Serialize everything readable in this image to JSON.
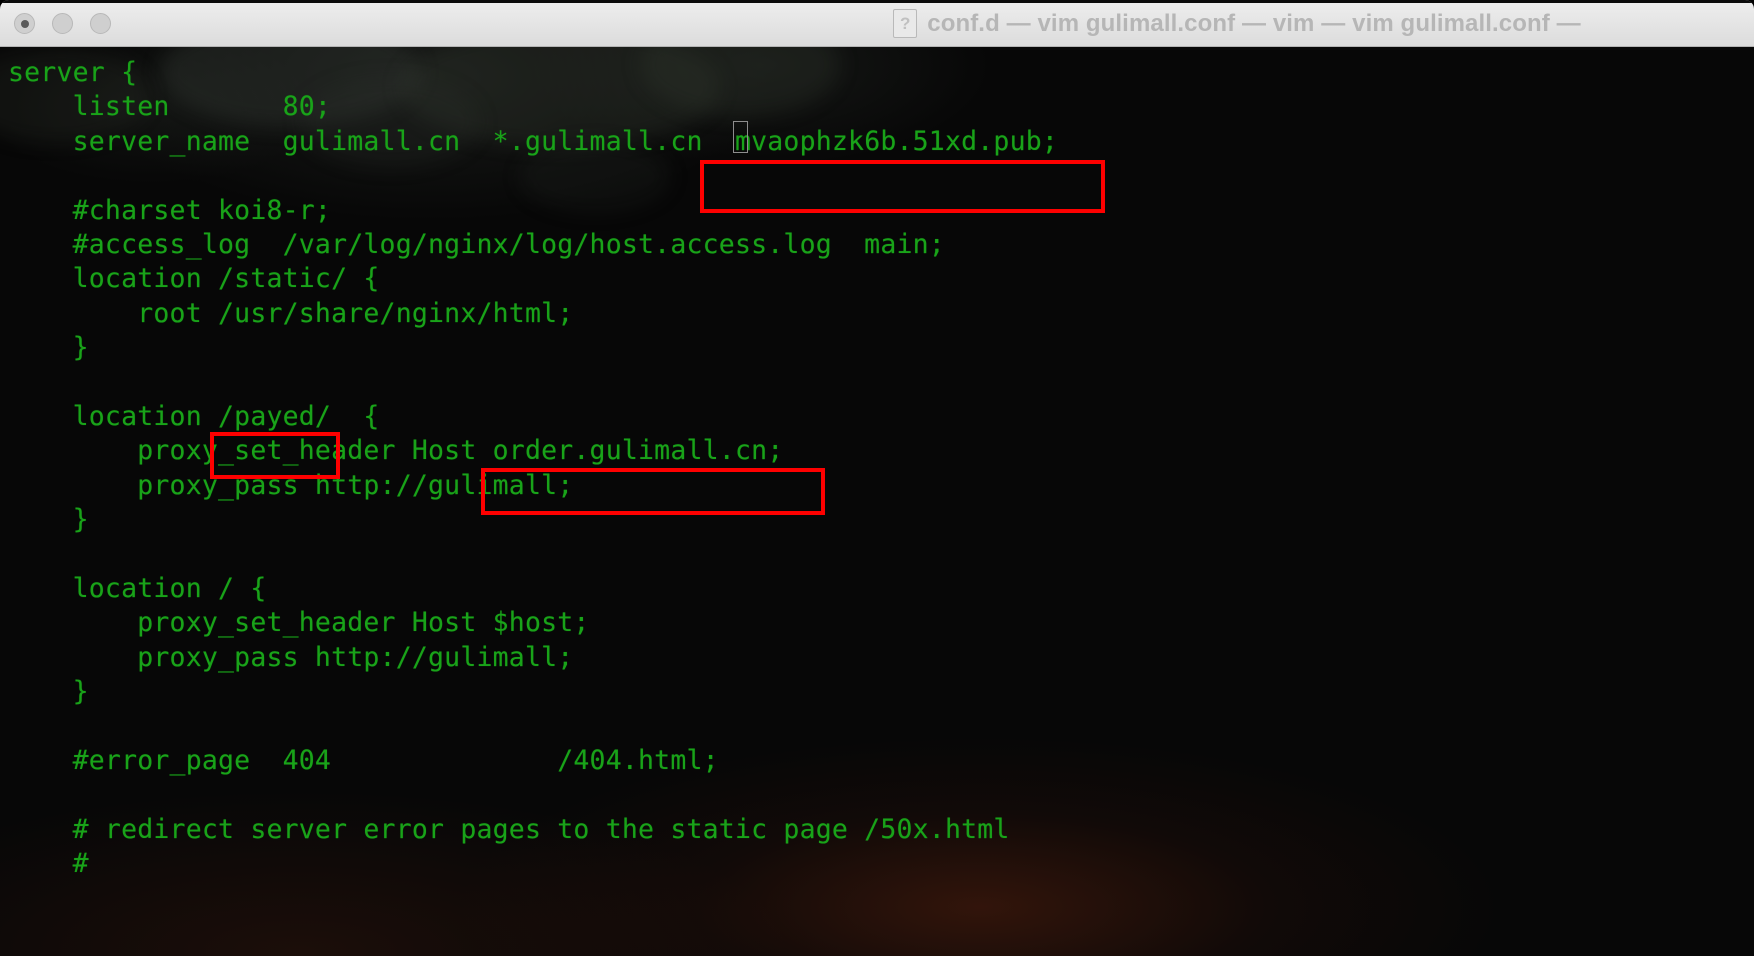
{
  "window": {
    "title": "conf.d — vim gulimall.conf — vim — vim gulimall.conf —",
    "doc_icon_glyph": "?",
    "traffic_lights": [
      {
        "name": "close",
        "label": "Close"
      },
      {
        "name": "minimize",
        "label": "Minimize"
      },
      {
        "name": "zoom",
        "label": "Zoom"
      }
    ]
  },
  "theme": {
    "terminal_bg": "#070707",
    "terminal_fg": "#19a319",
    "titlebar_bg": "#e6e6e6",
    "title_text": "#b6b6b6",
    "annotation": "#fe0000",
    "cursor_outline": "#8d8d8d"
  },
  "editor": {
    "file": "gulimall.conf",
    "cursor": {
      "line": 3,
      "char": "m"
    },
    "lines": [
      "server {",
      "    listen       80;",
      "    server_name  gulimall.cn  *.gulimall.cn  mvaophzk6b.51xd.pub;",
      "",
      "    #charset koi8-r;",
      "    #access_log  /var/log/nginx/log/host.access.log  main;",
      "    location /static/ {",
      "        root /usr/share/nginx/html;",
      "    }",
      "",
      "    location /payed/  {",
      "        proxy_set_header Host order.gulimall.cn;",
      "        proxy_pass http://gulimall;",
      "    }",
      "",
      "    location / {",
      "        proxy_set_header Host $host;",
      "        proxy_pass http://gulimall;",
      "    }",
      "",
      "    #error_page  404              /404.html;",
      "",
      "    # redirect server error pages to the static page /50x.html",
      "    #"
    ],
    "line_segments": [
      {
        "id": "l0",
        "pre": "server {",
        "cursor": "",
        "post": ""
      },
      {
        "id": "l1",
        "pre": "    listen       80;",
        "cursor": "",
        "post": ""
      },
      {
        "id": "l2",
        "pre": "    server_name  gulimall.cn  *.gulimall.cn  ",
        "cursor": "m",
        "post": "vaophzk6b.51xd.pub;"
      },
      {
        "id": "l3",
        "pre": "",
        "cursor": "",
        "post": ""
      },
      {
        "id": "l4",
        "pre": "    #charset koi8-r;",
        "cursor": "",
        "post": ""
      },
      {
        "id": "l5",
        "pre": "    #access_log  /var/log/nginx/log/host.access.log  main;",
        "cursor": "",
        "post": ""
      },
      {
        "id": "l6",
        "pre": "    location /static/ {",
        "cursor": "",
        "post": ""
      },
      {
        "id": "l7",
        "pre": "        root /usr/share/nginx/html;",
        "cursor": "",
        "post": ""
      },
      {
        "id": "l8",
        "pre": "    }",
        "cursor": "",
        "post": ""
      },
      {
        "id": "l9",
        "pre": "",
        "cursor": "",
        "post": ""
      },
      {
        "id": "l10",
        "pre": "    location /payed/  {",
        "cursor": "",
        "post": ""
      },
      {
        "id": "l11",
        "pre": "        proxy_set_header Host order.gulimall.cn;",
        "cursor": "",
        "post": ""
      },
      {
        "id": "l12",
        "pre": "        proxy_pass http://gulimall;",
        "cursor": "",
        "post": ""
      },
      {
        "id": "l13",
        "pre": "    }",
        "cursor": "",
        "post": ""
      },
      {
        "id": "l14",
        "pre": "",
        "cursor": "",
        "post": ""
      },
      {
        "id": "l15",
        "pre": "    location / {",
        "cursor": "",
        "post": ""
      },
      {
        "id": "l16",
        "pre": "        proxy_set_header Host $host;",
        "cursor": "",
        "post": ""
      },
      {
        "id": "l17",
        "pre": "        proxy_pass http://gulimall;",
        "cursor": "",
        "post": ""
      },
      {
        "id": "l18",
        "pre": "    }",
        "cursor": "",
        "post": ""
      },
      {
        "id": "l19",
        "pre": "",
        "cursor": "",
        "post": ""
      },
      {
        "id": "l20",
        "pre": "    #error_page  404              /404.html;",
        "cursor": "",
        "post": ""
      },
      {
        "id": "l21",
        "pre": "",
        "cursor": "",
        "post": ""
      },
      {
        "id": "l22",
        "pre": "    # redirect server error pages to the static page /50x.html",
        "cursor": "",
        "post": ""
      },
      {
        "id": "l23",
        "pre": "    #",
        "cursor": "",
        "post": ""
      }
    ]
  },
  "annotations": [
    {
      "id": "hostname",
      "text": "mvaophzk6b.51xd.pub;",
      "color": "#fe0000"
    },
    {
      "id": "payed",
      "text": "/payed/",
      "color": "#fe0000"
    },
    {
      "id": "order",
      "text": "order.gulimall.cn;",
      "color": "#fe0000"
    }
  ]
}
